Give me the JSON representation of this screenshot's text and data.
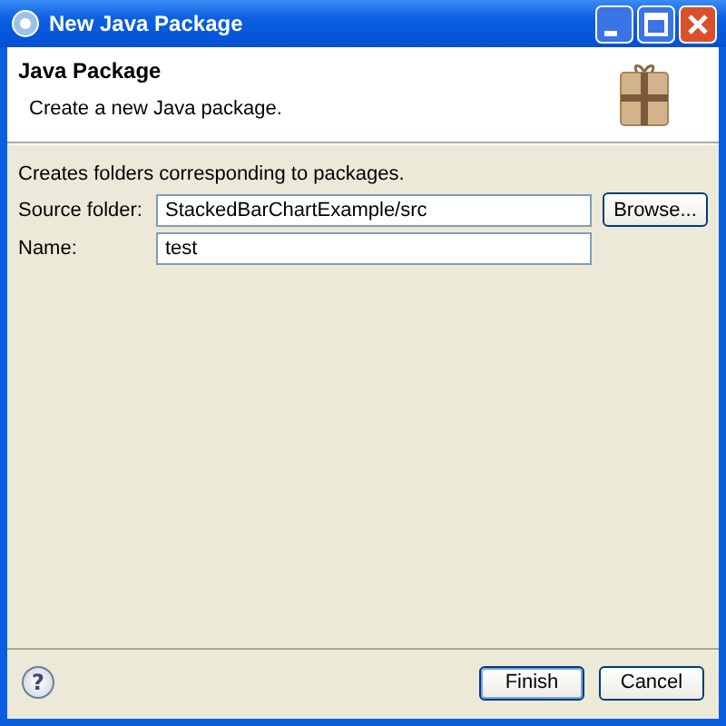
{
  "window": {
    "title": "New Java Package"
  },
  "header": {
    "title": "Java Package",
    "description": "Create a new Java package."
  },
  "body": {
    "intro": "Creates folders corresponding to packages.",
    "fields": [
      {
        "label": "Source folder:",
        "value": "StackedBarChartExample/src",
        "button": "Browse..."
      },
      {
        "label": "Name:",
        "value": "test"
      }
    ]
  },
  "footer": {
    "help": "?",
    "buttons": [
      {
        "label": "Finish",
        "default": true
      },
      {
        "label": "Cancel",
        "default": false
      }
    ]
  }
}
